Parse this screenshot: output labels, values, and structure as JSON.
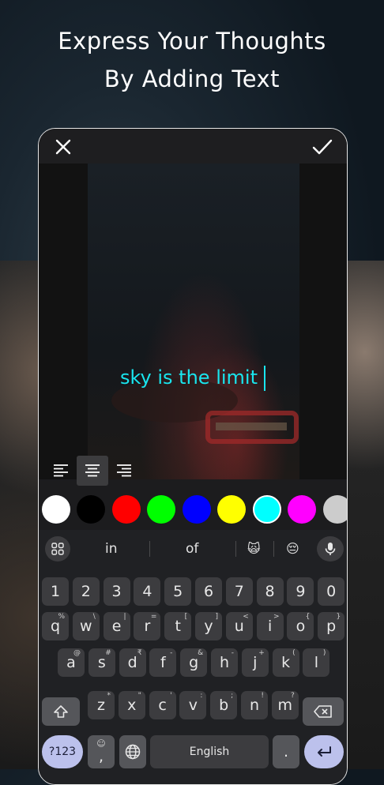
{
  "headline": {
    "line1": "Express Your Thoughts",
    "line2": "By Adding Text"
  },
  "editor": {
    "close_icon": "close-icon",
    "confirm_icon": "check-icon",
    "text_value": "sky is the limit",
    "text_color": "#19e5ee"
  },
  "alignment": {
    "options": [
      "align-left",
      "align-center",
      "align-right"
    ],
    "selected": "align-center"
  },
  "colors": [
    "#ffffff",
    "#000000",
    "#ff0000",
    "#00ff00",
    "#0000ff",
    "#ffff00",
    "#00ffff",
    "#ff00ff",
    "#cccccc"
  ],
  "selected_color": "#00ffff",
  "keyboard": {
    "suggestions": [
      "in",
      "of",
      "🙀",
      "😔"
    ],
    "number_row": [
      "1",
      "2",
      "3",
      "4",
      "5",
      "6",
      "7",
      "8",
      "9",
      "0"
    ],
    "row1": [
      {
        "k": "q",
        "h": "%"
      },
      {
        "k": "w",
        "h": "\\"
      },
      {
        "k": "e",
        "h": "|"
      },
      {
        "k": "r",
        "h": "="
      },
      {
        "k": "t",
        "h": "["
      },
      {
        "k": "y",
        "h": "]"
      },
      {
        "k": "u",
        "h": "<"
      },
      {
        "k": "i",
        "h": ">"
      },
      {
        "k": "o",
        "h": "{"
      },
      {
        "k": "p",
        "h": "}"
      }
    ],
    "row2": [
      {
        "k": "a",
        "h": "@"
      },
      {
        "k": "s",
        "h": "#"
      },
      {
        "k": "d",
        "h": "₹"
      },
      {
        "k": "f",
        "h": "-"
      },
      {
        "k": "g",
        "h": "&"
      },
      {
        "k": "h",
        "h": "-"
      },
      {
        "k": "j",
        "h": "+"
      },
      {
        "k": "k",
        "h": "("
      },
      {
        "k": "l",
        "h": ")"
      }
    ],
    "row3": [
      {
        "k": "z",
        "h": "*"
      },
      {
        "k": "x",
        "h": "\""
      },
      {
        "k": "c",
        "h": "'"
      },
      {
        "k": "v",
        "h": ":"
      },
      {
        "k": "b",
        "h": ";"
      },
      {
        "k": "n",
        "h": "!"
      },
      {
        "k": "m",
        "h": "?"
      }
    ],
    "symbols_key": "?123",
    "comma_key": ",",
    "comma_hint": "☺",
    "space_label": "English",
    "period_key": "."
  }
}
